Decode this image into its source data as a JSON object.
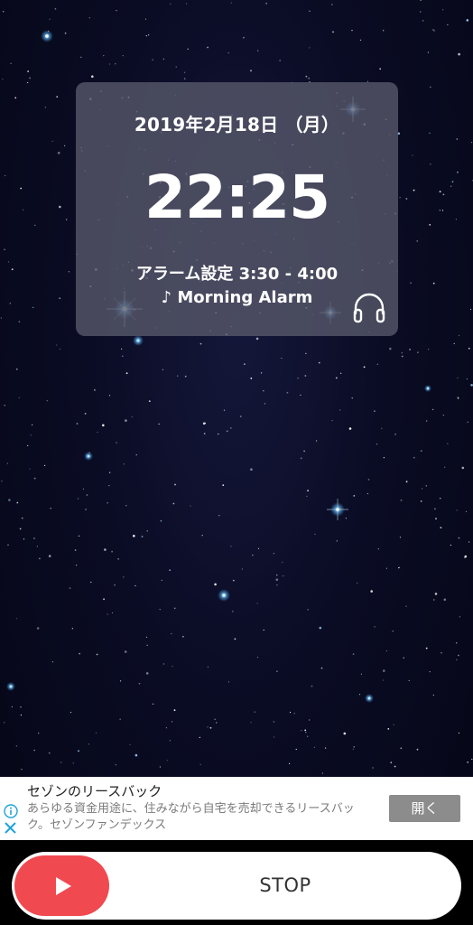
{
  "clock": {
    "date": "2019年2月18日 （月）",
    "time": "22:25",
    "alarm_range": "アラーム設定 3:30 - 4:00",
    "alarm_sound": "♪ Morning Alarm",
    "sound_icon": "headphones-icon"
  },
  "ad": {
    "title": "セゾンのリースバック",
    "body": "あらゆる資金用途に、住みながら自宅を売却できるリースバック。セゾンファンデックス",
    "open_label": "開く",
    "info_icon": "info-icon",
    "close_icon": "close-icon"
  },
  "controls": {
    "play_icon": "play-icon",
    "stop_label": "STOP",
    "accent_color": "#f0494f"
  }
}
